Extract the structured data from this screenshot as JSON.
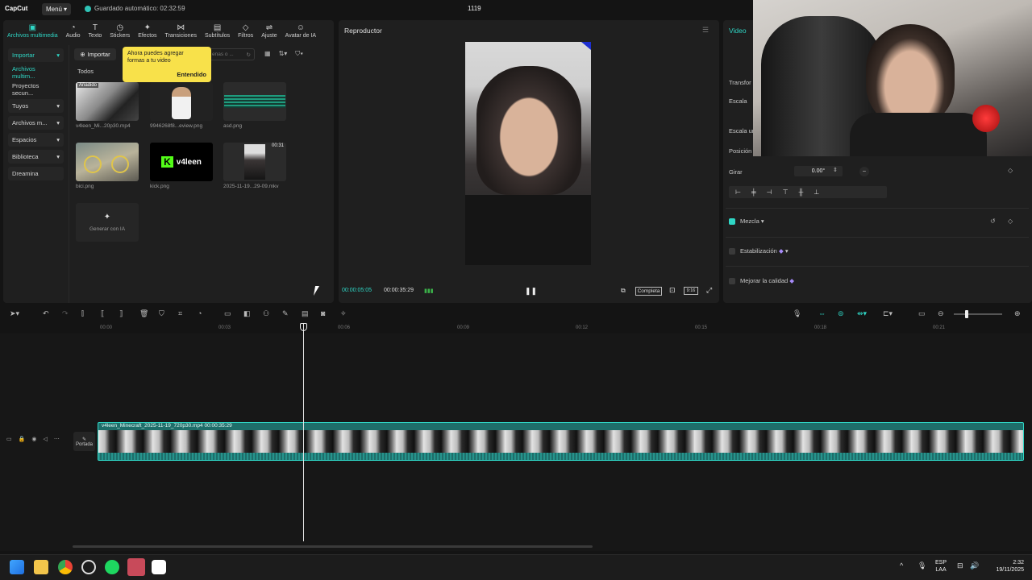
{
  "titlebar": {
    "logo": "CapCut",
    "menu": "Menú",
    "autosave": "Guardado automático: 02:32:59",
    "project_title": "1119"
  },
  "tool_tabs": [
    {
      "label": "Archivos multimedia",
      "icon": "media-icon",
      "glyph": "▣"
    },
    {
      "label": "Audio",
      "icon": "audio-icon",
      "glyph": "◔"
    },
    {
      "label": "Texto",
      "icon": "text-icon",
      "glyph": "T"
    },
    {
      "label": "Stickers",
      "icon": "sticker-icon",
      "glyph": "◷"
    },
    {
      "label": "Efectos",
      "icon": "effects-icon",
      "glyph": "✦"
    },
    {
      "label": "Transiciones",
      "icon": "transitions-icon",
      "glyph": "⋈"
    },
    {
      "label": "Subtítulos",
      "icon": "subtitles-icon",
      "glyph": "▤"
    },
    {
      "label": "Filtros",
      "icon": "filters-icon",
      "glyph": "◇"
    },
    {
      "label": "Ajuste",
      "icon": "adjust-icon",
      "glyph": "⇌"
    },
    {
      "label": "Avatar de IA",
      "icon": "ai-avatar-icon",
      "glyph": "☺"
    }
  ],
  "side_nav": [
    {
      "label": "Importar",
      "chevron": "▾"
    },
    {
      "label": "Archivos multim...",
      "chevron": ""
    },
    {
      "label": "Proyectos secun...",
      "chevron": ""
    },
    {
      "label": "Tuyos",
      "chevron": "▾"
    },
    {
      "label": "Archivos m...",
      "chevron": "▾"
    },
    {
      "label": "Espacios",
      "chevron": "▾"
    },
    {
      "label": "Biblioteca",
      "chevron": "▾"
    },
    {
      "label": "Dreamina",
      "chevron": ""
    }
  ],
  "media": {
    "import_label": "Importar",
    "tooltip_text": "Ahora puedes agregar formas a tu video",
    "tooltip_ok": "Entendido",
    "search_placeholder": "enas o ...",
    "filter_all": "Todos",
    "added_badge": "Añadido",
    "generate_ai": "Generar con IA",
    "items": [
      {
        "label": "v4leen_Mi...20p30.mp4",
        "badge": ""
      },
      {
        "label": "9946268f8...eview.png",
        "badge": ""
      },
      {
        "label": "asd.png",
        "badge": ""
      },
      {
        "label": "bici.png",
        "badge": ""
      },
      {
        "label": "kick.png",
        "badge": ""
      },
      {
        "label": "2025-11-19...29-09.mkv",
        "badge": "00:31"
      }
    ],
    "kick_text": "v4leen"
  },
  "player": {
    "title": "Reproductor",
    "time_current": "00:00:05:05",
    "time_total": "00:00:35:29",
    "full_label": "Completa",
    "ratio_label": "9:16"
  },
  "props": {
    "tab": "Video",
    "transform": "Transfor",
    "scale": "Escala",
    "scale_uniform": "Escala ur",
    "position": "Posición",
    "rotate": "Girar",
    "rotate_value": "0.00°",
    "blend": "Mezcla",
    "stabilization": "Estabilización",
    "enhance": "Mejorar la calidad"
  },
  "timeline": {
    "ticks": [
      "00:00",
      "00:03",
      "00:06",
      "00:09",
      "00:12",
      "00:15",
      "00:18",
      "00:21"
    ],
    "cover_label": "Portada",
    "clip_label": "v4leen_Minecraft_2025-11-19_720p30.mp4   00:00:35:29"
  },
  "taskbar": {
    "lang": "ESP",
    "lang_sub": "LAA",
    "time": "2:32",
    "date": "19/11/2025"
  },
  "colors": {
    "accent": "#2fd6c5",
    "tooltip": "#f8e14a",
    "clip": "#1e6e6a"
  }
}
